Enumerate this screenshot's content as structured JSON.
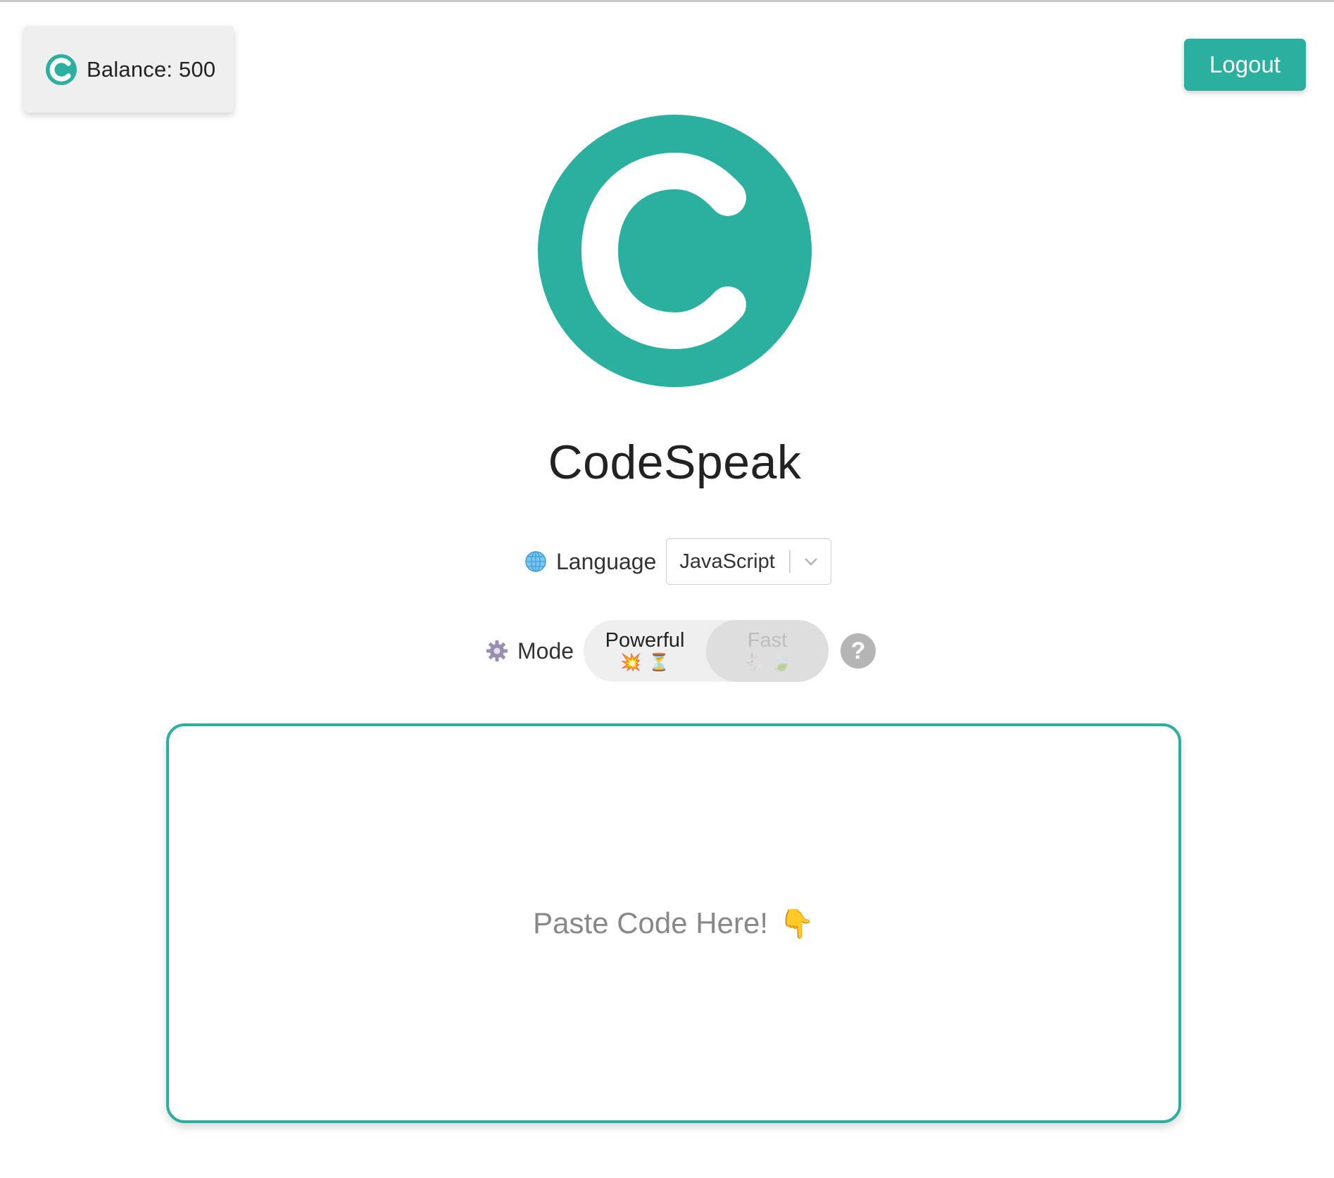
{
  "brand": {
    "accent_color": "#2bb0a0",
    "app_title": "CodeSpeak",
    "logo_icon": "codespeak-c-logo"
  },
  "balance": {
    "label": "Balance: 500",
    "icon": "codespeak-c-logo"
  },
  "header": {
    "logout_label": "Logout"
  },
  "language": {
    "icon": "globe-icon",
    "label": "Language",
    "selected": "JavaScript",
    "dropdown_icon": "chevron-down-icon"
  },
  "mode": {
    "icon": "gear-icon",
    "label": "Mode",
    "options": [
      {
        "label": "Powerful",
        "emoji": "💥⏳",
        "selected": true
      },
      {
        "label": "Fast",
        "emoji": "🐇🍃",
        "selected": false
      }
    ],
    "help_icon": "question-mark-icon"
  },
  "code_input": {
    "placeholder": "Paste Code Here!",
    "pointer_emoji": "👇"
  }
}
